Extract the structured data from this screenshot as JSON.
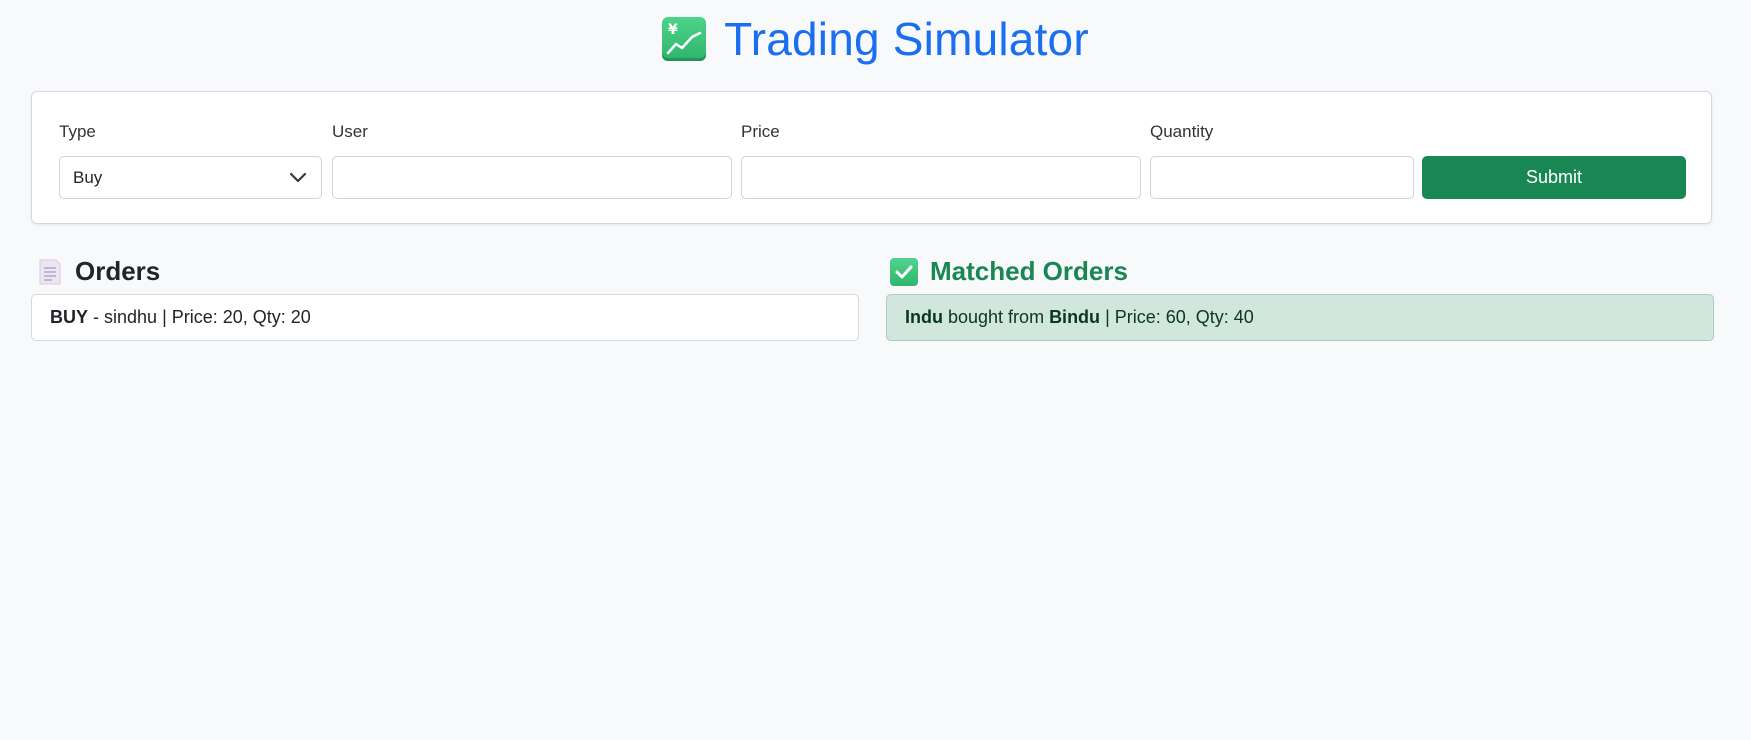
{
  "header": {
    "title": "Trading Simulator",
    "icon": "chart-increasing-yen-icon"
  },
  "form": {
    "type_label": "Type",
    "type_value": "Buy",
    "user_label": "User",
    "user_value": "",
    "price_label": "Price",
    "price_value": "",
    "quantity_label": "Quantity",
    "quantity_value": "",
    "submit_label": "Submit"
  },
  "orders": {
    "heading": "Orders",
    "icon": "document-icon",
    "items": [
      {
        "side": "BUY",
        "sep": " - ",
        "user": "sindhu",
        "details": " | Price: 20, Qty: 20"
      }
    ]
  },
  "matched": {
    "heading": "Matched Orders",
    "icon": "check-mark-icon",
    "items": [
      {
        "buyer": "Indu",
        "verb": " bought from ",
        "seller": "Bindu",
        "details": " | Price: 60, Qty: 40"
      }
    ]
  },
  "colors": {
    "title": "#1a6ff0",
    "submit": "#198754",
    "matched_heading": "#198754",
    "matched_bg": "#d1e7dd",
    "page_bg": "#f8f9fa"
  }
}
